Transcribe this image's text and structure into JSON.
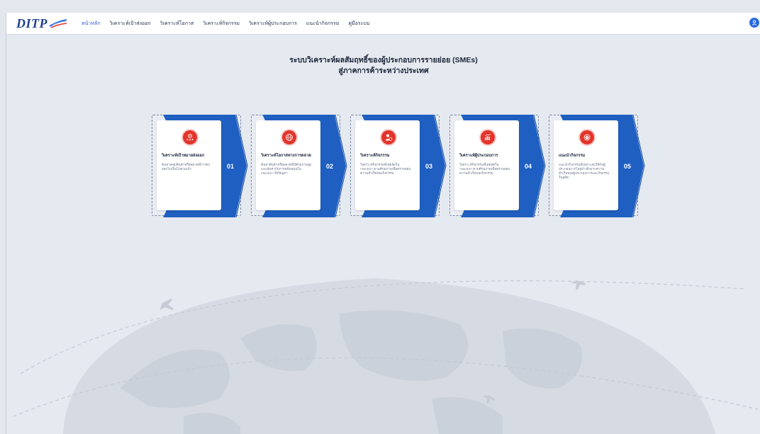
{
  "header": {
    "logo_text": "DITP",
    "nav": [
      {
        "label": "หน้าหลัก",
        "active": true
      },
      {
        "label": "วิเคราะห์เป้าส่งออก"
      },
      {
        "label": "วิเคราะห์โอกาส"
      },
      {
        "label": "วิเคราะห์กิจกรรม"
      },
      {
        "label": "วิเคราะห์ผู้ประกอบการ"
      },
      {
        "label": "แนะนำกิจกรรม"
      },
      {
        "label": "คู่มือระบบ"
      }
    ],
    "avatar_icon": "user-icon"
  },
  "hero": {
    "title_line1": "ระบบวิเคราะห์ผลสัมฤทธิ์ของผู้ประกอบการรายย่อย (SMEs)",
    "title_line2": "สู่ภาคการค้าระหว่างประเทศ"
  },
  "cards": [
    {
      "number": "01",
      "title": "วิเคราะห์เป้าหมายส่งออก",
      "desc": "ค้นหาคลุ่มสินค้าหรือตลาดที่การส่งออกไม่เป็นไปตามเป้า",
      "icon": "target-people-icon"
    },
    {
      "number": "02",
      "title": "วิเคราะห์โอกาสทางการตลาด",
      "desc": "ค้นหาสินค้าหรือตลาดที่มีศักยภาพสูงและคุ้มค่ากับการสนับสนุนใน <sector> ที่มีปัญหา",
      "icon": "globe-icon"
    },
    {
      "number": "03",
      "title": "วิเคราะห์กิจกรรม",
      "desc": "วิเคราะห์กิจกรรมที่เคยจัดใน <sector> ตามศักยภาพเพื่อตรวจสอบความสำเร็จของกิจกรรม",
      "icon": "person-check-icon"
    },
    {
      "number": "04",
      "title": "วิเคราะห์ผู้ประกอบการ",
      "desc": "วิเคราะห์กิจกรรมที่เคยจัดใน <sector> ตามศักยภาพเพื่อตรวจสอบความสำเร็จของกิจกรรม",
      "icon": "chart-analysis-icon"
    },
    {
      "number": "05",
      "title": "แนะนำกิจกรรม",
      "desc": "แนะนำกิจกรรมที่เหมาะสมให้กับผู้ประกอบการโดยอ้างอิงจากความสำเร็จของผู้ประกอบการและกิจกรรมในอดีต",
      "icon": "recommend-icon"
    }
  ],
  "colors": {
    "brand_blue": "#1e5fc1",
    "icon_red": "#e2342b",
    "accent_link": "#2f5bd8"
  }
}
